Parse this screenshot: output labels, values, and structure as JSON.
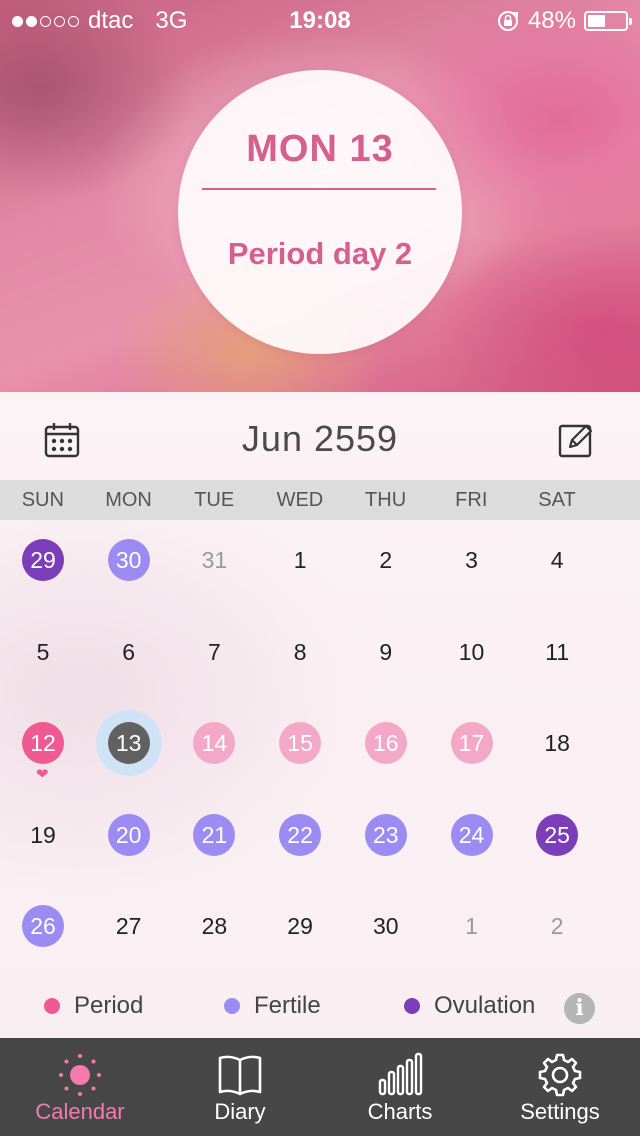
{
  "status_bar": {
    "signal_bars_filled": 2,
    "signal_bars_total": 5,
    "carrier": "dtac",
    "network": "3G",
    "time": "19:08",
    "battery_percent": "48%",
    "battery_level": 0.48,
    "icons": [
      "rotation-lock-icon",
      "battery-icon"
    ]
  },
  "day_summary": {
    "title": "MON 13",
    "subtitle": "Period day 2"
  },
  "calendar": {
    "month_label": "Jun 2559",
    "weekdays": [
      "SUN",
      "MON",
      "TUE",
      "WED",
      "THU",
      "FRI",
      "SAT"
    ],
    "weeks": [
      [
        {
          "d": "29",
          "s": "ovulation"
        },
        {
          "d": "30",
          "s": "fertile"
        },
        {
          "d": "31",
          "s": "muted"
        },
        {
          "d": "1",
          "s": ""
        },
        {
          "d": "2",
          "s": ""
        },
        {
          "d": "3",
          "s": ""
        },
        {
          "d": "4",
          "s": ""
        }
      ],
      [
        {
          "d": "5",
          "s": ""
        },
        {
          "d": "6",
          "s": ""
        },
        {
          "d": "7",
          "s": ""
        },
        {
          "d": "8",
          "s": ""
        },
        {
          "d": "9",
          "s": ""
        },
        {
          "d": "10",
          "s": ""
        },
        {
          "d": "11",
          "s": ""
        }
      ],
      [
        {
          "d": "12",
          "s": "period",
          "heart": true
        },
        {
          "d": "13",
          "s": "today"
        },
        {
          "d": "14",
          "s": "predicted"
        },
        {
          "d": "15",
          "s": "predicted"
        },
        {
          "d": "16",
          "s": "predicted"
        },
        {
          "d": "17",
          "s": "predicted"
        },
        {
          "d": "18",
          "s": ""
        }
      ],
      [
        {
          "d": "19",
          "s": ""
        },
        {
          "d": "20",
          "s": "fertile"
        },
        {
          "d": "21",
          "s": "fertile"
        },
        {
          "d": "22",
          "s": "fertile"
        },
        {
          "d": "23",
          "s": "fertile"
        },
        {
          "d": "24",
          "s": "fertile"
        },
        {
          "d": "25",
          "s": "ovulation"
        }
      ],
      [
        {
          "d": "26",
          "s": "fertile"
        },
        {
          "d": "27",
          "s": ""
        },
        {
          "d": "28",
          "s": ""
        },
        {
          "d": "29",
          "s": ""
        },
        {
          "d": "30",
          "s": ""
        },
        {
          "d": "1",
          "s": "muted"
        },
        {
          "d": "2",
          "s": "muted"
        }
      ]
    ],
    "icons": {
      "left": "calendar-grid-icon",
      "right": "edit-note-icon"
    }
  },
  "legend": {
    "items": [
      {
        "label": "Period",
        "color": "#ef5a92"
      },
      {
        "label": "Fertile",
        "color": "#9b8bf2"
      },
      {
        "label": "Ovulation",
        "color": "#7b3db8"
      }
    ],
    "info_glyph": "i"
  },
  "tabs": [
    {
      "label": "Calendar",
      "icon": "sun-icon",
      "active": true
    },
    {
      "label": "Diary",
      "icon": "book-icon",
      "active": false
    },
    {
      "label": "Charts",
      "icon": "bar-chart-icon",
      "active": false
    },
    {
      "label": "Settings",
      "icon": "gear-icon",
      "active": false
    }
  ],
  "colors": {
    "accent": "#d6608c",
    "period": "#ef5a92",
    "predicted_period": "#f4a8c7",
    "fertile": "#9b8bf2",
    "ovulation": "#7b3db8",
    "today": "#616161",
    "tab_active": "#f47ab0",
    "tabbar_bg": "#474747"
  }
}
